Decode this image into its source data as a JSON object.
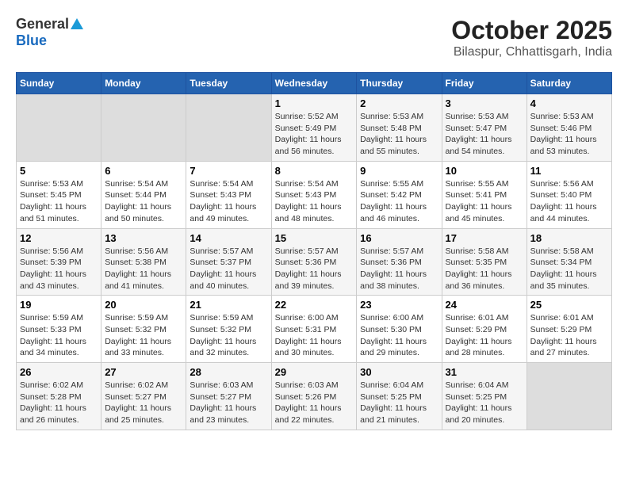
{
  "logo": {
    "general": "General",
    "blue": "Blue"
  },
  "title": "October 2025",
  "subtitle": "Bilaspur, Chhattisgarh, India",
  "days_of_week": [
    "Sunday",
    "Monday",
    "Tuesday",
    "Wednesday",
    "Thursday",
    "Friday",
    "Saturday"
  ],
  "weeks": [
    [
      {
        "day": "",
        "sunrise": "",
        "sunset": "",
        "daylight": "",
        "empty": true
      },
      {
        "day": "",
        "sunrise": "",
        "sunset": "",
        "daylight": "",
        "empty": true
      },
      {
        "day": "",
        "sunrise": "",
        "sunset": "",
        "daylight": "",
        "empty": true
      },
      {
        "day": "1",
        "sunrise": "5:52 AM",
        "sunset": "5:49 PM",
        "daylight": "11 hours and 56 minutes."
      },
      {
        "day": "2",
        "sunrise": "5:53 AM",
        "sunset": "5:48 PM",
        "daylight": "11 hours and 55 minutes."
      },
      {
        "day": "3",
        "sunrise": "5:53 AM",
        "sunset": "5:47 PM",
        "daylight": "11 hours and 54 minutes."
      },
      {
        "day": "4",
        "sunrise": "5:53 AM",
        "sunset": "5:46 PM",
        "daylight": "11 hours and 53 minutes."
      }
    ],
    [
      {
        "day": "5",
        "sunrise": "5:53 AM",
        "sunset": "5:45 PM",
        "daylight": "11 hours and 51 minutes."
      },
      {
        "day": "6",
        "sunrise": "5:54 AM",
        "sunset": "5:44 PM",
        "daylight": "11 hours and 50 minutes."
      },
      {
        "day": "7",
        "sunrise": "5:54 AM",
        "sunset": "5:43 PM",
        "daylight": "11 hours and 49 minutes."
      },
      {
        "day": "8",
        "sunrise": "5:54 AM",
        "sunset": "5:43 PM",
        "daylight": "11 hours and 48 minutes."
      },
      {
        "day": "9",
        "sunrise": "5:55 AM",
        "sunset": "5:42 PM",
        "daylight": "11 hours and 46 minutes."
      },
      {
        "day": "10",
        "sunrise": "5:55 AM",
        "sunset": "5:41 PM",
        "daylight": "11 hours and 45 minutes."
      },
      {
        "day": "11",
        "sunrise": "5:56 AM",
        "sunset": "5:40 PM",
        "daylight": "11 hours and 44 minutes."
      }
    ],
    [
      {
        "day": "12",
        "sunrise": "5:56 AM",
        "sunset": "5:39 PM",
        "daylight": "11 hours and 43 minutes."
      },
      {
        "day": "13",
        "sunrise": "5:56 AM",
        "sunset": "5:38 PM",
        "daylight": "11 hours and 41 minutes."
      },
      {
        "day": "14",
        "sunrise": "5:57 AM",
        "sunset": "5:37 PM",
        "daylight": "11 hours and 40 minutes."
      },
      {
        "day": "15",
        "sunrise": "5:57 AM",
        "sunset": "5:36 PM",
        "daylight": "11 hours and 39 minutes."
      },
      {
        "day": "16",
        "sunrise": "5:57 AM",
        "sunset": "5:36 PM",
        "daylight": "11 hours and 38 minutes."
      },
      {
        "day": "17",
        "sunrise": "5:58 AM",
        "sunset": "5:35 PM",
        "daylight": "11 hours and 36 minutes."
      },
      {
        "day": "18",
        "sunrise": "5:58 AM",
        "sunset": "5:34 PM",
        "daylight": "11 hours and 35 minutes."
      }
    ],
    [
      {
        "day": "19",
        "sunrise": "5:59 AM",
        "sunset": "5:33 PM",
        "daylight": "11 hours and 34 minutes."
      },
      {
        "day": "20",
        "sunrise": "5:59 AM",
        "sunset": "5:32 PM",
        "daylight": "11 hours and 33 minutes."
      },
      {
        "day": "21",
        "sunrise": "5:59 AM",
        "sunset": "5:32 PM",
        "daylight": "11 hours and 32 minutes."
      },
      {
        "day": "22",
        "sunrise": "6:00 AM",
        "sunset": "5:31 PM",
        "daylight": "11 hours and 30 minutes."
      },
      {
        "day": "23",
        "sunrise": "6:00 AM",
        "sunset": "5:30 PM",
        "daylight": "11 hours and 29 minutes."
      },
      {
        "day": "24",
        "sunrise": "6:01 AM",
        "sunset": "5:29 PM",
        "daylight": "11 hours and 28 minutes."
      },
      {
        "day": "25",
        "sunrise": "6:01 AM",
        "sunset": "5:29 PM",
        "daylight": "11 hours and 27 minutes."
      }
    ],
    [
      {
        "day": "26",
        "sunrise": "6:02 AM",
        "sunset": "5:28 PM",
        "daylight": "11 hours and 26 minutes."
      },
      {
        "day": "27",
        "sunrise": "6:02 AM",
        "sunset": "5:27 PM",
        "daylight": "11 hours and 25 minutes."
      },
      {
        "day": "28",
        "sunrise": "6:03 AM",
        "sunset": "5:27 PM",
        "daylight": "11 hours and 23 minutes."
      },
      {
        "day": "29",
        "sunrise": "6:03 AM",
        "sunset": "5:26 PM",
        "daylight": "11 hours and 22 minutes."
      },
      {
        "day": "30",
        "sunrise": "6:04 AM",
        "sunset": "5:25 PM",
        "daylight": "11 hours and 21 minutes."
      },
      {
        "day": "31",
        "sunrise": "6:04 AM",
        "sunset": "5:25 PM",
        "daylight": "11 hours and 20 minutes."
      },
      {
        "day": "",
        "sunrise": "",
        "sunset": "",
        "daylight": "",
        "empty": true
      }
    ]
  ],
  "labels": {
    "sunrise_prefix": "Sunrise: ",
    "sunset_prefix": "Sunset: ",
    "daylight_label": "Daylight: "
  }
}
